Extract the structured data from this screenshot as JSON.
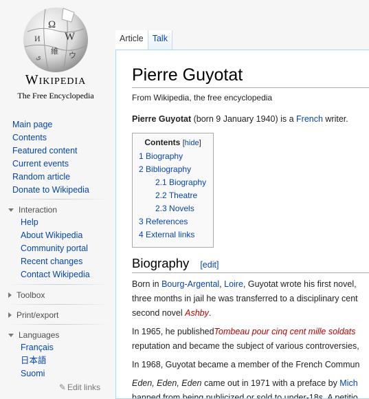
{
  "logo": {
    "wordmark": "Wikipedia",
    "tagline": "The Free Encyclopedia"
  },
  "nav": [
    "Main page",
    "Contents",
    "Featured content",
    "Current events",
    "Random article",
    "Donate to Wikipedia"
  ],
  "interaction": {
    "label": "Interaction",
    "items": [
      "Help",
      "About Wikipedia",
      "Community portal",
      "Recent changes",
      "Contact Wikipedia"
    ]
  },
  "toolbox": {
    "label": "Toolbox"
  },
  "printexport": {
    "label": "Print/export"
  },
  "languages": {
    "label": "Languages",
    "items": [
      "Français",
      "日本語",
      "Suomi"
    ],
    "edit_links": "Edit links"
  },
  "tabs": {
    "article": "Article",
    "talk": "Talk"
  },
  "article": {
    "title": "Pierre Guyotat",
    "sitesub": "From Wikipedia, the free encyclopedia",
    "lead": {
      "bold": "Pierre Guyotat",
      "text1": " (born 9 January 1940) is a ",
      "link": "French",
      "text2": " writer."
    },
    "toc": {
      "title": "Contents",
      "hide": "hide",
      "items": [
        {
          "num": "1",
          "label": "Biography"
        },
        {
          "num": "2",
          "label": "Bibliography"
        },
        {
          "num": "2.1",
          "label": "Biography"
        },
        {
          "num": "2.2",
          "label": "Theatre"
        },
        {
          "num": "2.3",
          "label": "Novels"
        },
        {
          "num": "3",
          "label": "References"
        },
        {
          "num": "4",
          "label": "External links"
        }
      ]
    },
    "section": {
      "heading": "Biography",
      "edit": "[edit]"
    },
    "p1": {
      "t1": "Born in ",
      "l1": "Bourg-Argental",
      "t2": ", ",
      "l2": "Loire",
      "t3": ", Guyotat wrote his first novel, ",
      "line2": "three months in jail he was transferred to a disciplinary cent",
      "t4": "second novel ",
      "l3": "Ashby",
      "t5": "."
    },
    "p2": {
      "t1": "In 1965, he published",
      "l1": "Tombeau pour cinq cent mille soldats",
      "line2": "reputation and became the subject of various controversies,"
    },
    "p3": {
      "t1": "In 1968, Guyotat became a member of the French Commun"
    },
    "p4": {
      "i1": "Eden, Eden, Eden",
      "t1": " came out in 1971 with a preface by ",
      "l1": "Mich",
      "line2": "banned from being publicized or sold to under-18s. A petitio"
    }
  }
}
